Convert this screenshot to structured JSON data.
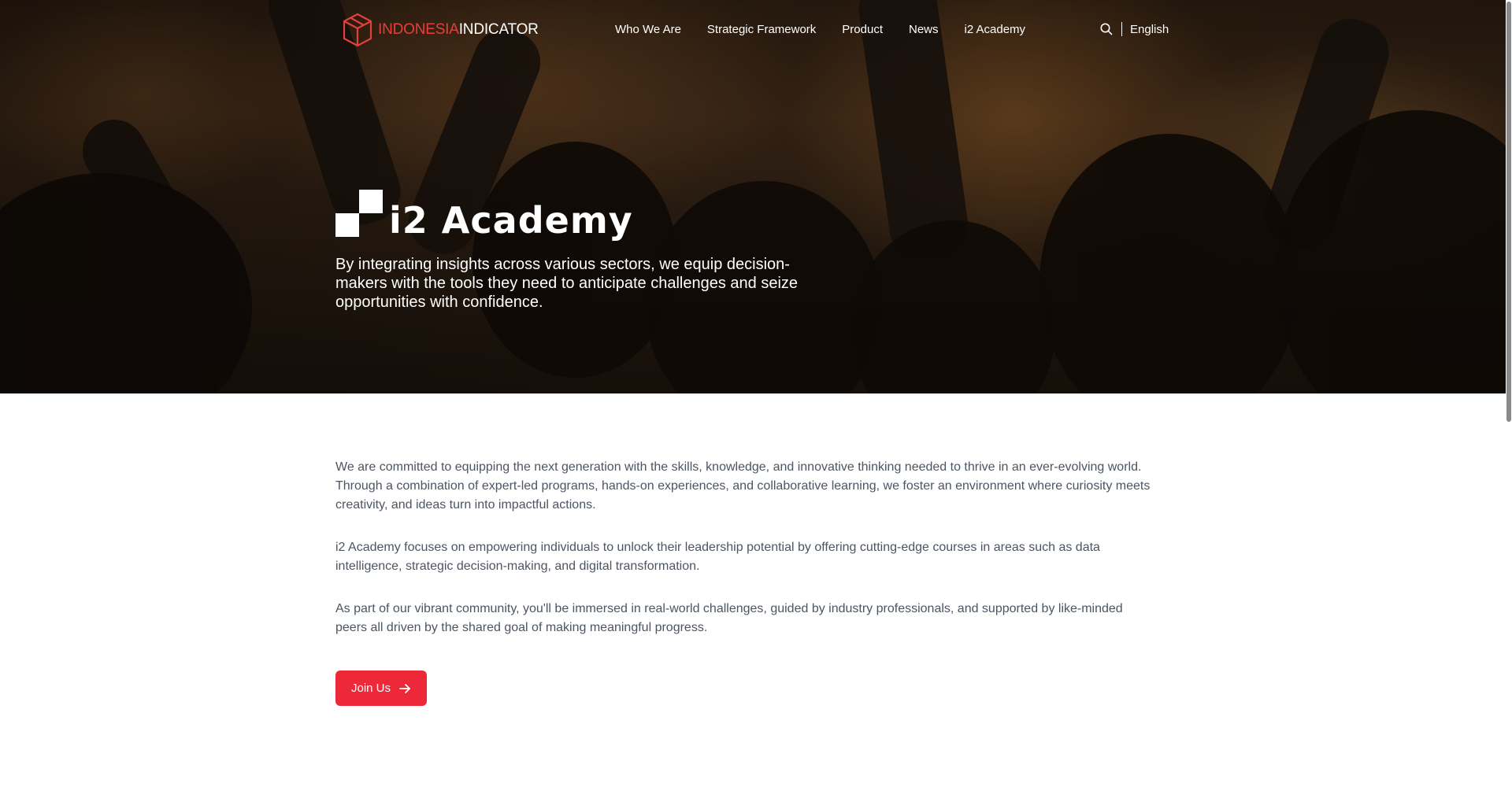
{
  "brand": {
    "logo_red": "INDONESIA",
    "logo_white": "INDICATOR",
    "red_color": "#e2403f"
  },
  "nav": {
    "items": [
      {
        "label": "Who We Are"
      },
      {
        "label": "Strategic Framework"
      },
      {
        "label": "Product"
      },
      {
        "label": "News"
      },
      {
        "label": "i2 Academy"
      }
    ],
    "search_icon": "search-icon",
    "language": "English"
  },
  "hero": {
    "title": "i2 Academy",
    "subtitle": "By integrating insights across various sectors, we equip decision-makers with the tools they need to anticipate challenges and seize opportunities with confidence."
  },
  "main": {
    "paragraphs": [
      "We are committed to equipping the next generation with the skills, knowledge, and innovative thinking needed to thrive in an ever-evolving world. Through a combination of expert-led programs, hands-on experiences, and collaborative learning, we foster an environment where curiosity meets creativity, and ideas turn into impactful actions.",
      "i2 Academy focuses on empowering individuals to unlock their leadership potential by offering cutting-edge courses in areas such as data intelligence, strategic decision-making, and digital transformation.",
      "As part of our vibrant community, you'll be immersed in real-world challenges, guided by industry professionals, and supported by like-minded peers all driven by the shared goal of making meaningful progress."
    ],
    "join_label": "Join Us",
    "join_icon": "arrow-right-icon",
    "accent_color": "#ec2839"
  }
}
